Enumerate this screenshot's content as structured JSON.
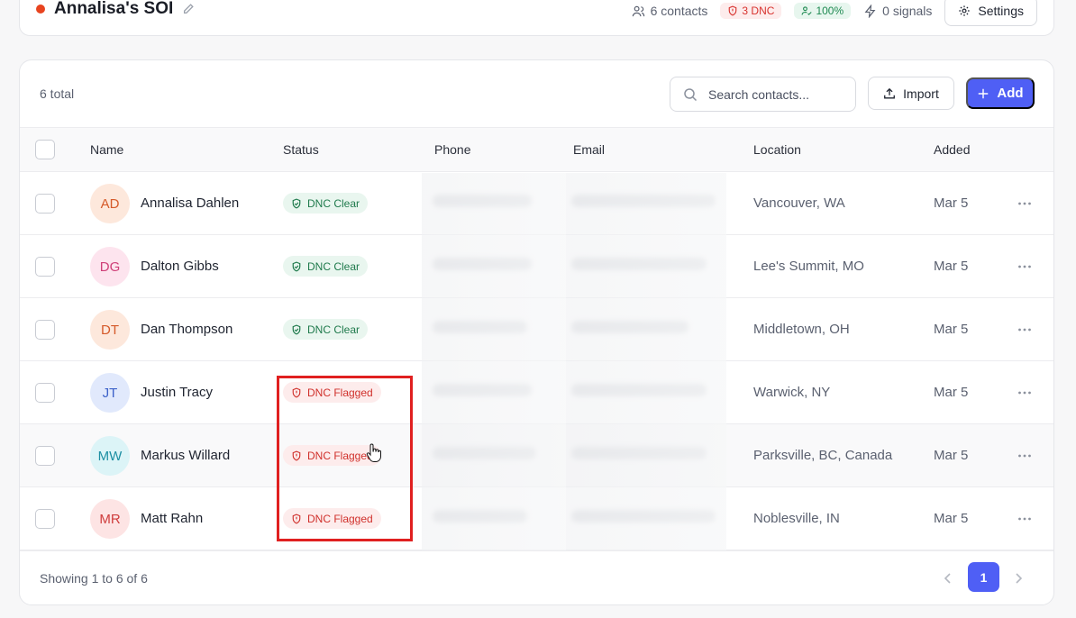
{
  "header": {
    "title": "Annalisa's SOI",
    "contacts_label": "6 contacts",
    "dnc_label": "3 DNC",
    "pct_label": "100%",
    "signals_label": "0 signals",
    "settings_label": "Settings"
  },
  "toolbar": {
    "total_label": "6 total",
    "search_placeholder": "Search contacts...",
    "import_label": "Import",
    "add_label": "Add"
  },
  "table": {
    "columns": [
      "Name",
      "Status",
      "Phone",
      "Email",
      "Location",
      "Added"
    ],
    "rows": [
      {
        "initials": "AD",
        "name": "Annalisa Dahlen",
        "status": "DNC Clear",
        "location": "Vancouver, WA",
        "added": "Mar 5"
      },
      {
        "initials": "DG",
        "name": "Dalton Gibbs",
        "status": "DNC Clear",
        "location": "Lee's Summit, MO",
        "added": "Mar 5"
      },
      {
        "initials": "DT",
        "name": "Dan Thompson",
        "status": "DNC Clear",
        "location": "Middletown, OH",
        "added": "Mar 5"
      },
      {
        "initials": "JT",
        "name": "Justin Tracy",
        "status": "DNC Flagged",
        "location": "Warwick, NY",
        "added": "Mar 5"
      },
      {
        "initials": "MW",
        "name": "Markus Willard",
        "status": "DNC Flagged",
        "location": "Parksville, BC, Canada",
        "added": "Mar 5"
      },
      {
        "initials": "MR",
        "name": "Matt Rahn",
        "status": "DNC Flagged",
        "location": "Noblesville, IN",
        "added": "Mar 5"
      }
    ]
  },
  "footer": {
    "showing_label": "Showing 1 to 6 of 6",
    "current_page": "1"
  },
  "colors": {
    "accent": "#4f5ff5",
    "status_dot": "#e8441f",
    "dnc_red": "#d0302b",
    "clear_green": "#1f7a4c",
    "highlight": "#e02020"
  }
}
